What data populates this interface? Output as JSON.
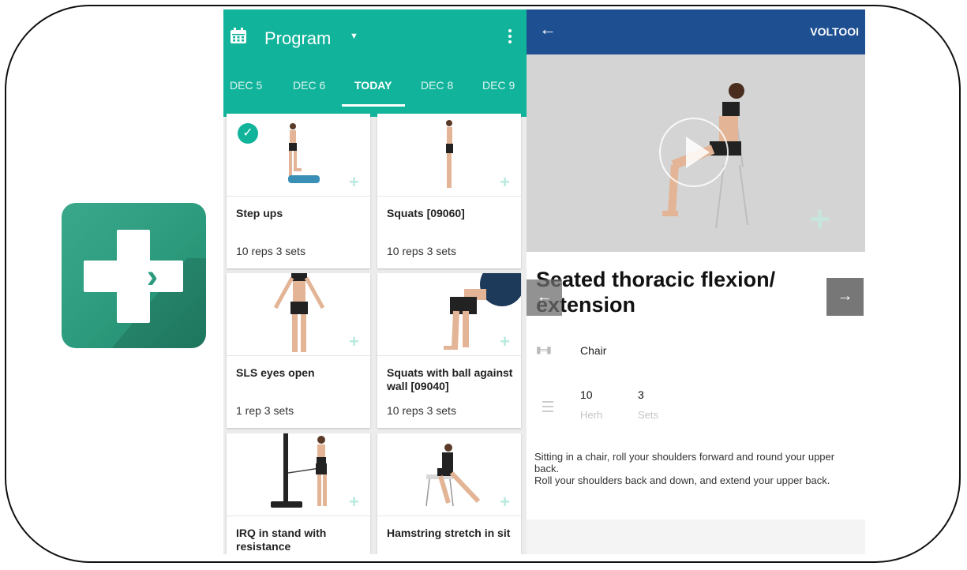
{
  "colors": {
    "teal": "#12b39b",
    "navy": "#1d4f91",
    "icon_green": "#2c9a7c"
  },
  "app_icon": {
    "name": "plus-chevrons-app-icon"
  },
  "program": {
    "title": "Program",
    "tabs": [
      {
        "label": "DEC 5"
      },
      {
        "label": "DEC 6"
      },
      {
        "label": "TODAY",
        "active": true
      },
      {
        "label": "DEC 8"
      },
      {
        "label": "DEC 9"
      }
    ],
    "exercises": [
      {
        "name": "Step ups",
        "reps": "10 reps 3 sets",
        "done": true
      },
      {
        "name": "Squats [09060]",
        "reps": "10 reps 3 sets"
      },
      {
        "name": "SLS eyes open",
        "reps": "1 rep 3 sets"
      },
      {
        "name": "Squats with ball against wall [09040]",
        "reps": "10 reps 3 sets"
      },
      {
        "name": "IRQ in stand with resistance",
        "reps": ""
      },
      {
        "name": "Hamstring stretch in sit",
        "reps": ""
      }
    ]
  },
  "detail": {
    "action": "VOLTOOI",
    "title": "Seated thoracic flexion/ extension",
    "equipment": "Chair",
    "herh_value": "10",
    "herh_label": "Herh",
    "sets_value": "3",
    "sets_label": "Sets",
    "description": "Sitting in a chair, roll your shoulders forward and round your upper back.\nRoll your shoulders back and down, and extend your upper back.",
    "prev_arrow": "←",
    "next_arrow": "→"
  }
}
